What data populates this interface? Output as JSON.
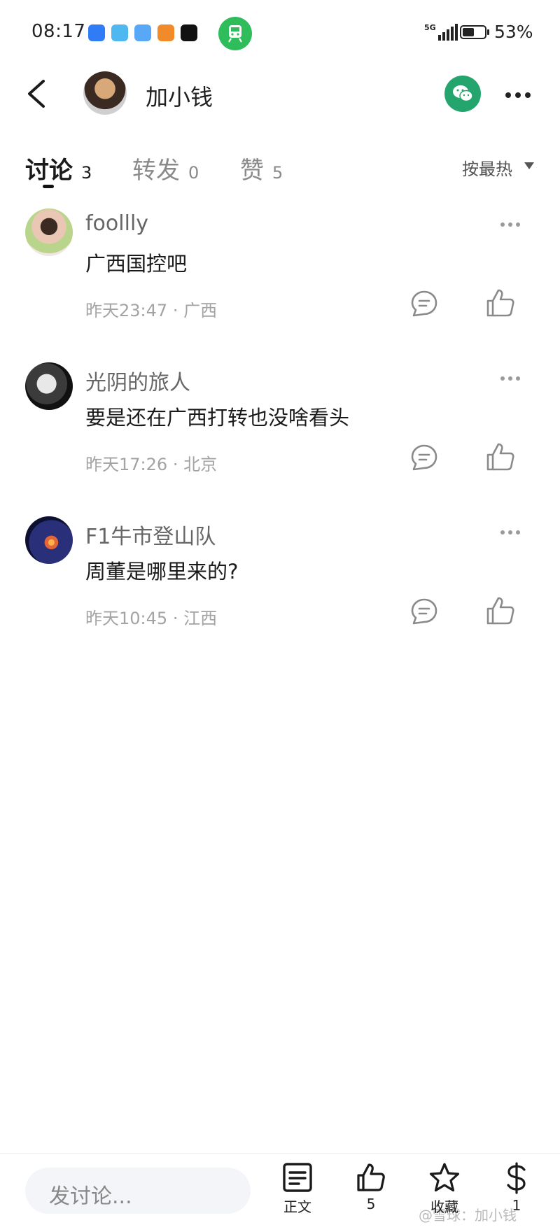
{
  "status_bar": {
    "time": "08:17",
    "network": "5G",
    "battery": "53%",
    "battery_level": 0.53
  },
  "header": {
    "title": "加小钱"
  },
  "tabs": [
    {
      "label": "讨论",
      "count": "3"
    },
    {
      "label": "转发",
      "count": "0"
    },
    {
      "label": "赞",
      "count": "5"
    }
  ],
  "sort": {
    "label": "按最热"
  },
  "comments": [
    {
      "author": "foollly",
      "text": "广西国控吧",
      "time": "昨天23:47",
      "location": "广西"
    },
    {
      "author": "光阴的旅人",
      "text": "要是还在广西打转也没啥看头",
      "time": "昨天17:26",
      "location": "北京"
    },
    {
      "author": "F1牛市登山队",
      "text": "周董是哪里来的?",
      "time": "昨天10:45",
      "location": "江西"
    }
  ],
  "meta_separator": "·",
  "bottom_bar": {
    "input_placeholder": "发讨论...",
    "article_label": "正文",
    "like_count": "5",
    "favorite_label": "收藏",
    "reward_count": "1"
  },
  "watermark": "@雪球：加小钱",
  "colors": {
    "accent_green": "#23a56d",
    "train_green": "#2fbd5b"
  }
}
